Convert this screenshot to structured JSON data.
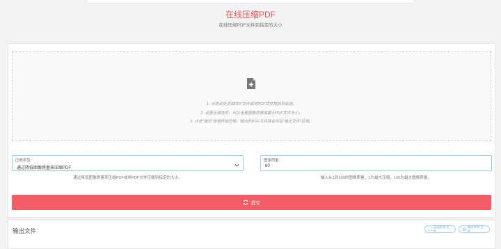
{
  "header": {
    "title": "在线压缩PDF",
    "subtitle": "在线压缩PDF文件到指定的大小"
  },
  "upload": {
    "icon": "file-plus-icon",
    "instructions": [
      "1. 点击此处添加PDF文件或将PDF文件拖放到此处。",
      "2. 设置压缩选项，可以设置图像质量或最大PDF文件大小。",
      "3. 点击\"提交\"按钮开始压缩，输出的PDF文件将会列在\"输出文件\"区域。"
    ]
  },
  "options": {
    "compression_type": {
      "label": "压缩类型:",
      "value": "通过降低图像质量来压缩PDF",
      "help": "通过降低图像质量来压缩PDF或将PDF文件压缩到指定的大小。"
    },
    "image_quality": {
      "label": "图像质量：",
      "value": "60",
      "help": "输入从1到100的图像质量，1为最大压缩，100为最大图像质量。"
    }
  },
  "submit": {
    "label": "提交",
    "icon": "refresh-icon"
  },
  "output": {
    "title": "输出文件",
    "buttons": [
      {
        "label": "压缩所有文件",
        "icon": "expand-icon"
      },
      {
        "label": "删除所有文件",
        "icon": "close-circle-icon"
      }
    ]
  },
  "colors": {
    "accent": "#e8545b",
    "button": "#f25d66",
    "field_border": "#9ec9e8"
  }
}
